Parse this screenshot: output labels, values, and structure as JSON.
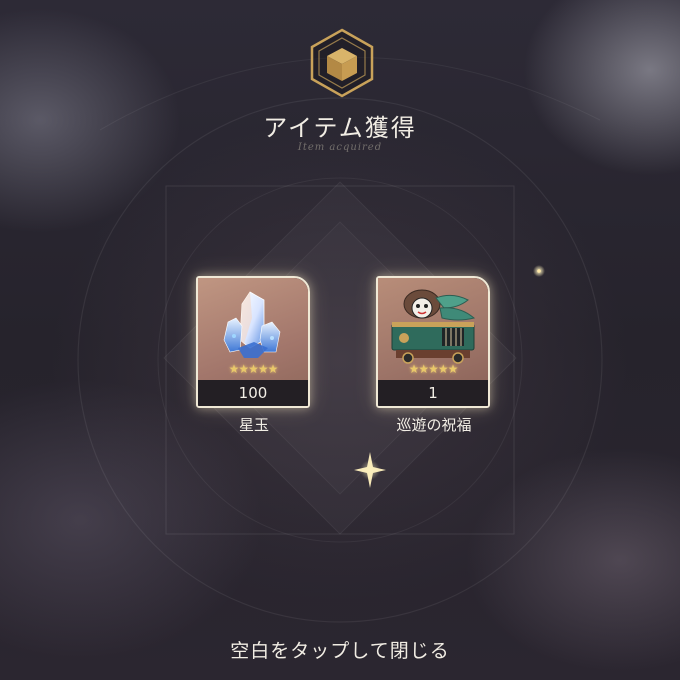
{
  "dialog": {
    "title": "アイテム獲得",
    "subtitle": "Item acquired",
    "emblem_icon": "box-icon",
    "close_hint": "空白をタップして閉じる"
  },
  "items": [
    {
      "name": "星玉",
      "count": "100",
      "rarity_stars": 5,
      "icon": "crystal-icon"
    },
    {
      "name": "巡遊の祝福",
      "count": "1",
      "rarity_stars": 5,
      "icon": "parade-float-icon"
    }
  ],
  "colors": {
    "gold": "#c9a25a",
    "card_border": "#f0e9d6",
    "count_bar": "#231f24",
    "text": "#f1ede4"
  }
}
